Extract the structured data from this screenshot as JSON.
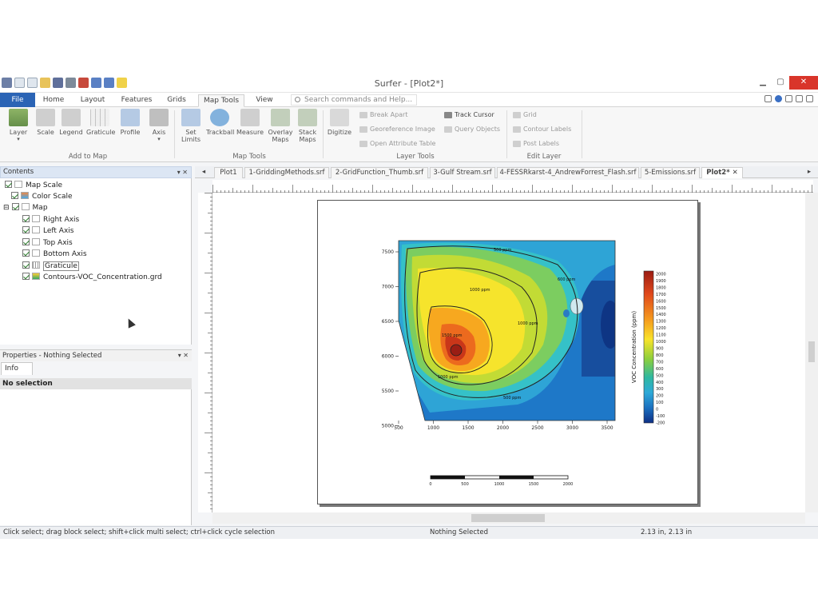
{
  "app": {
    "title": "Surfer - [Plot2*]"
  },
  "ribbon_tabs": [
    "File",
    "Home",
    "Layout",
    "Features",
    "Grids",
    "Map Tools",
    "View"
  ],
  "active_tab": "Map Tools",
  "search_placeholder": "Search commands and Help...",
  "ribbon": {
    "add_to_map": {
      "label": "Add to Map",
      "buttons": [
        "Layer",
        "Scale",
        "Legend",
        "Graticule",
        "Profile",
        "Axis"
      ]
    },
    "map_tools": {
      "label": "Map Tools",
      "buttons": [
        "Set Limits",
        "Trackball",
        "Measure",
        "Overlay Maps",
        "Stack Maps"
      ]
    },
    "layer_tools": {
      "label": "Layer Tools",
      "digitize": "Digitize",
      "break_apart": "Break Apart",
      "georeference": "Georeference Image",
      "open_attribute": "Open Attribute Table",
      "track_cursor": "Track Cursor",
      "query_objects": "Query Objects"
    },
    "edit_layer": {
      "label": "Edit Layer",
      "grid": "Grid",
      "contour_labels": "Contour Labels",
      "post_labels": "Post Labels"
    }
  },
  "contents": {
    "header": "Contents",
    "items": [
      "Map Scale",
      "Color Scale",
      "Map",
      "Right Axis",
      "Left Axis",
      "Top Axis",
      "Bottom Axis",
      "Graticule",
      "Contours-VOC_Concentration.grd"
    ]
  },
  "properties": {
    "header": "Properties - Nothing Selected",
    "tab": "Info",
    "selection": "No selection"
  },
  "doc_tabs": [
    "Plot1",
    "1-GriddingMethods.srf",
    "2-GridFunction_Thumb.srf",
    "3-Gulf Stream.srf",
    "4-FESSRkarst-4_AndrewForrest_Flash.srf",
    "5-Emissions.srf",
    "Plot2*"
  ],
  "active_doc": "Plot2*",
  "plot": {
    "y_ticks": [
      "7500",
      "7000",
      "6500",
      "6000",
      "5500",
      "5000"
    ],
    "x_ticks": [
      "500",
      "1000",
      "1500",
      "2000",
      "2500",
      "3000",
      "3500"
    ],
    "contour_labels": [
      "500 ppm",
      "1000 ppm",
      "1500 ppm",
      "1000 ppm",
      "500 ppm",
      "600 ppm",
      "1000 ppm"
    ],
    "colorbar": {
      "title": "VOC Concentration (ppm)",
      "labels": [
        "2000",
        "1900",
        "1800",
        "1700",
        "1600",
        "1500",
        "1400",
        "1300",
        "1200",
        "1100",
        "1000",
        "900",
        "800",
        "700",
        "600",
        "500",
        "400",
        "300",
        "200",
        "100",
        "0",
        "-100",
        "-200"
      ]
    },
    "scalebar": [
      "0",
      "500",
      "1000",
      "1500",
      "2000"
    ]
  },
  "status": {
    "hint": "Click  select; drag  block select; shift+click  multi select; ctrl+click  cycle selection",
    "selection": "Nothing Selected",
    "coords": "2.13 in, 2.13 in"
  },
  "colors": {
    "file_tab": "#2b64b5",
    "close_button": "#d9352a",
    "contents_header": "#dce6f4"
  }
}
